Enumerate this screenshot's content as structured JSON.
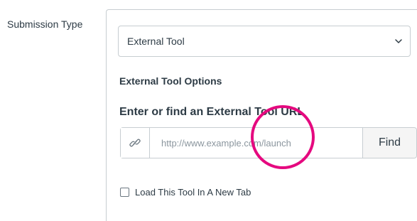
{
  "form": {
    "submission_type_label": "Submission Type",
    "submission_type_value": "External Tool",
    "options_heading": "External Tool Options",
    "url_heading": "Enter or find an External Tool URL",
    "url_placeholder": "http://www.example.com/launch",
    "url_value": "",
    "find_button_label": "Find",
    "new_tab_checkbox_label": "Load This Tool In A New Tab",
    "new_tab_checked": false
  },
  "icons": {
    "link": "link-icon",
    "dropdown": "chevron-down-icon"
  },
  "colors": {
    "highlight_ring": "#e5097f",
    "border": "#c7cdd1",
    "text": "#2d3b45",
    "button_bg": "#f5f5f5"
  }
}
